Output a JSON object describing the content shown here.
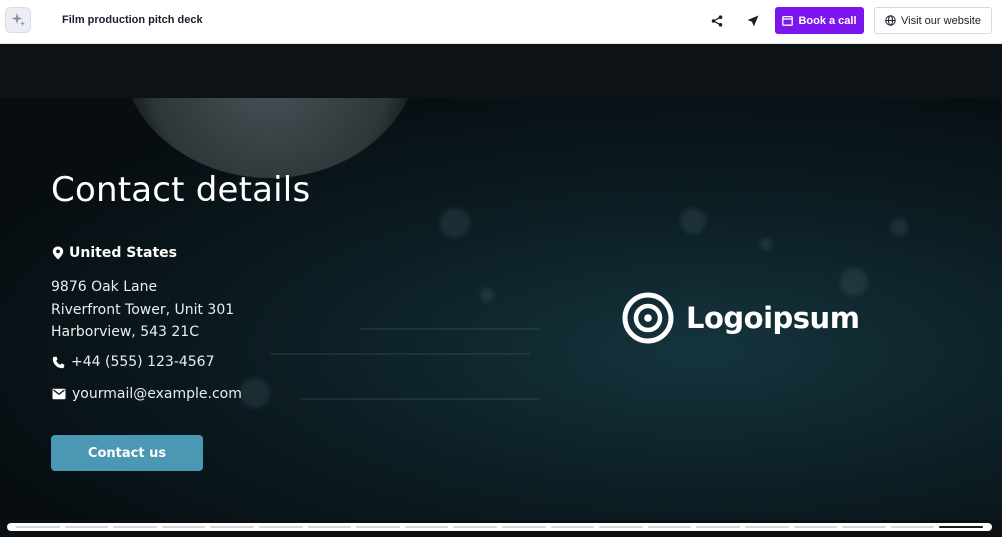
{
  "header": {
    "title": "Film production pitch deck",
    "book_label": "Book a call",
    "visit_label": "Visit our website",
    "app_icon": "sparkle-icon",
    "share_icon": "share-icon",
    "send_icon": "send-icon",
    "book_icon": "calendar-icon",
    "visit_icon": "globe-icon",
    "accent_color": "#7b16ee"
  },
  "slide": {
    "heading": "Contact details",
    "country": "United States",
    "address_lines": [
      "9876 Oak Lane",
      "Riverfront Tower, Unit 301",
      "Harborview, 543 21C"
    ],
    "phone": "+44 (555) 123-4567",
    "email": "yourmail@example.com",
    "cta_label": "Contact us",
    "cta_color": "#4a98b3",
    "logo_text": "Logoipsum",
    "icons": {
      "location": "map-pin-icon",
      "phone": "phone-icon",
      "email": "mail-icon",
      "logo": "target-logo-icon"
    }
  },
  "progress": {
    "total_slides": 20,
    "current_slide": 20
  }
}
